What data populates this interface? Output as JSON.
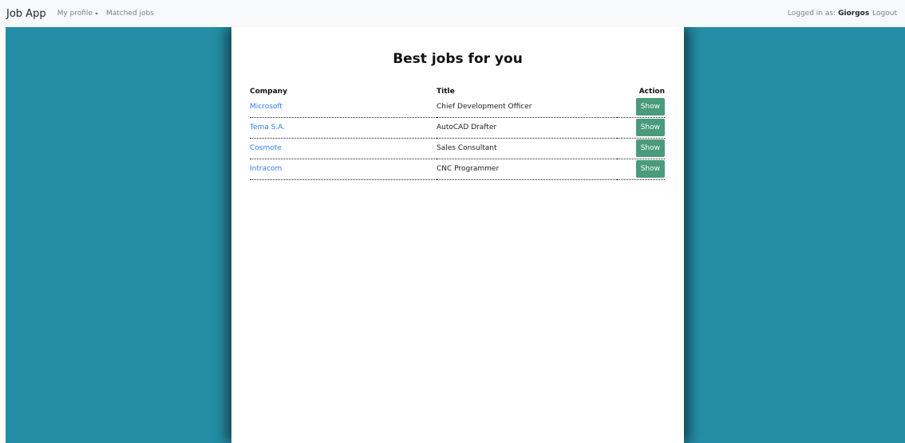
{
  "navbar": {
    "brand": "Job App",
    "my_profile": "My profile",
    "matched_jobs": "Matched jobs",
    "logged_in_label": "Logged in as:",
    "username": "Giorgos",
    "logout": "Logout"
  },
  "main": {
    "title": "Best jobs for you",
    "columns": {
      "company": "Company",
      "title": "Title",
      "action": "Action"
    },
    "rows": [
      {
        "company": "Microsoft",
        "title": "Chief Development Officer",
        "action": "Show"
      },
      {
        "company": "Tema S.A.",
        "title": "AutoCAD Drafter",
        "action": "Show"
      },
      {
        "company": "Cosmote",
        "title": "Sales Consultant",
        "action": "Show"
      },
      {
        "company": "Intracom",
        "title": "CNC Programmer",
        "action": "Show"
      }
    ]
  },
  "colors": {
    "background": "#258ea6",
    "button": "#4a9a7e",
    "link": "#2f80ed",
    "navbar": "#f8f9fa"
  },
  "icons": {
    "dropdown": "caret-down-icon"
  }
}
